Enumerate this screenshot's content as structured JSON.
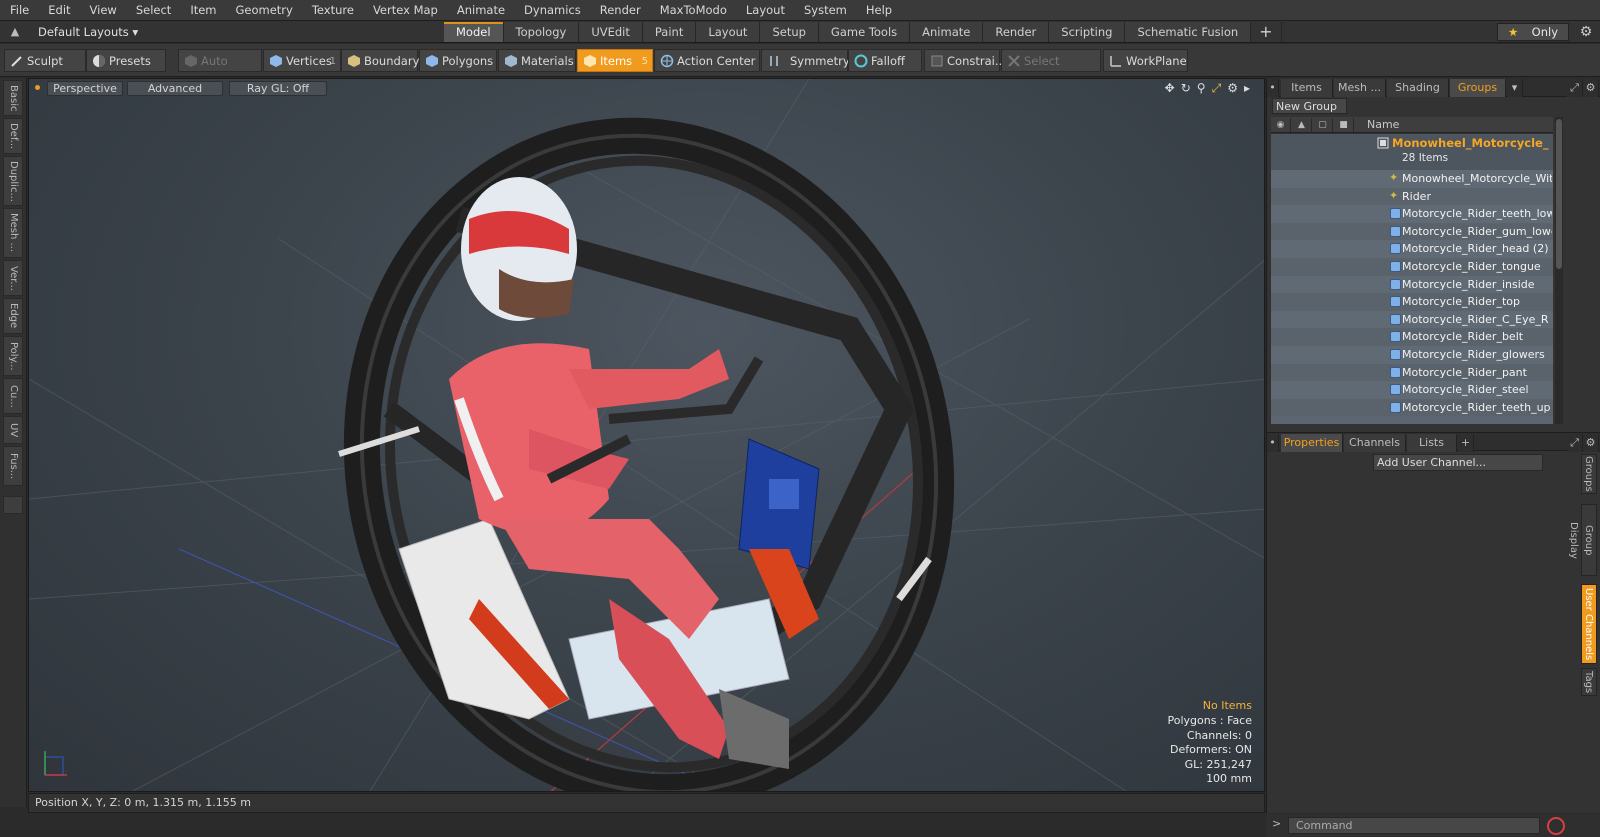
{
  "menu": [
    "File",
    "Edit",
    "View",
    "Select",
    "Item",
    "Geometry",
    "Texture",
    "Vertex Map",
    "Animate",
    "Dynamics",
    "Render",
    "MaxToModo",
    "Layout",
    "System",
    "Help"
  ],
  "layout_selector": "Default Layouts",
  "tabs": [
    "Model",
    "Topology",
    "UVEdit",
    "Paint",
    "Layout",
    "Setup",
    "Game Tools",
    "Animate",
    "Render",
    "Scripting",
    "Schematic Fusion"
  ],
  "active_tab": "Model",
  "only_button": "Only",
  "toolbar": {
    "sculpt": "Sculpt",
    "presets": "Presets",
    "auto_select": "Auto Select",
    "vertices": "Vertices",
    "vertices_count": "1",
    "boundary": "Boundary",
    "polygons": "Polygons",
    "materials": "Materials",
    "items": "Items",
    "items_count": "5",
    "action_center": "Action Center",
    "symmetry": "Symmetry",
    "falloff": "Falloff",
    "constraints": "Constrai...",
    "select_through": "Select Through",
    "workplane": "WorkPlane"
  },
  "left_tabs": [
    "Basic",
    "Def...",
    "Duplic...",
    "Mesh ...",
    "Ver...",
    "Edge",
    "Poly...",
    "Cu...",
    "UV",
    "Fus..."
  ],
  "viewport": {
    "view": "Perspective",
    "shading": "Advanced",
    "raygl": "Ray GL: Off",
    "info": {
      "no_items": "No Items",
      "polygons": "Polygons : Face",
      "channels": "Channels: 0",
      "deformers": "Deformers: ON",
      "gl": "GL: 251,247",
      "scale": "100 mm"
    }
  },
  "status": "Position X, Y, Z:   0 m, 1.315 m, 1.155 m",
  "right_panel": {
    "tabs": [
      "Items",
      "Mesh ...",
      "Shading",
      "Groups"
    ],
    "active_tab": "Groups",
    "new_group": "New Group",
    "name_header": "Name",
    "group_name": "Monowheel_Motorcycle_ ...",
    "group_count": "28 Items",
    "items": [
      {
        "label": "Monowheel_Motorcycle_Wit...",
        "kind": "locator"
      },
      {
        "label": "Rider",
        "kind": "locator"
      },
      {
        "label": "Motorcycle_Rider_teeth_lower",
        "kind": "mesh"
      },
      {
        "label": "Motorcycle_Rider_gum_lower",
        "kind": "mesh"
      },
      {
        "label": "Motorcycle_Rider_head (2)",
        "kind": "mesh"
      },
      {
        "label": "Motorcycle_Rider_tongue",
        "kind": "mesh"
      },
      {
        "label": "Motorcycle_Rider_inside",
        "kind": "mesh"
      },
      {
        "label": "Motorcycle_Rider_top",
        "kind": "mesh"
      },
      {
        "label": "Motorcycle_Rider_C_Eye_R",
        "kind": "mesh"
      },
      {
        "label": "Motorcycle_Rider_belt",
        "kind": "mesh"
      },
      {
        "label": "Motorcycle_Rider_glowers",
        "kind": "mesh"
      },
      {
        "label": "Motorcycle_Rider_pant",
        "kind": "mesh"
      },
      {
        "label": "Motorcycle_Rider_steel",
        "kind": "mesh"
      },
      {
        "label": "Motorcycle_Rider_teeth_up ...",
        "kind": "mesh"
      }
    ],
    "props_tabs": [
      "Properties",
      "Channels",
      "Lists"
    ],
    "active_props_tab": "Properties",
    "add_user_channel": "Add User Channel...",
    "side_tabs": [
      "Groups",
      "Group Display",
      "User Channels",
      "Tags"
    ],
    "active_side_tab": "User Channels"
  },
  "command_placeholder": "Command",
  "colors": {
    "accent": "#f09a1e",
    "group_title": "#f6a623",
    "viewport_bg": "#3c444c"
  }
}
